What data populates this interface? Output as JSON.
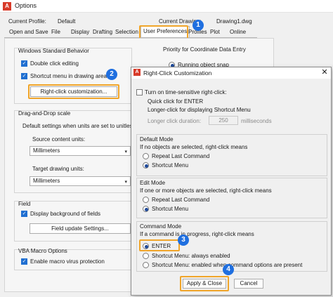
{
  "window": {
    "title": "Options",
    "icon_text": "A"
  },
  "profile": {
    "current_profile_label": "Current Profile:",
    "current_profile_value": "Default",
    "current_drawing_label": "Current Drawing:",
    "current_drawing_value": "Drawing1.dwg"
  },
  "tabs": [
    {
      "label": "Open and Save"
    },
    {
      "label": "File"
    },
    {
      "label": "Display"
    },
    {
      "label": "Drafting"
    },
    {
      "label": "Selection"
    },
    {
      "label": "User Preferences"
    },
    {
      "label": "Profiles"
    },
    {
      "label": "Plot"
    },
    {
      "label": "Online"
    }
  ],
  "windows_behavior": {
    "title": "Windows Standard Behavior",
    "double_click": "Double click editing",
    "shortcut_menu": "Shortcut menu in drawing area",
    "rc_button": "Right-click customization..."
  },
  "priority": {
    "title": "Priority for Coordinate Data Entry",
    "running_snap": "Running object snap"
  },
  "drag_drop": {
    "title": "Drag-and-Drop scale",
    "default_text": "Default settings when units are set to unitless",
    "source_label": "Source content units:",
    "source_value": "Millimeters",
    "target_label": "Target drawing units:",
    "target_value": "Millimeters"
  },
  "field": {
    "title": "Field",
    "display_background": "Display background of fields",
    "update_button": "Field update Settings..."
  },
  "vba": {
    "title": "VBA Macro Options",
    "enable_protection": "Enable macro virus protection"
  },
  "dialog": {
    "title": "Right-Click Customization",
    "time_sensitive": "Turn on time-sensitive right-click:",
    "quick_click": "Quick click for ENTER",
    "longer_click": "Longer-click for displaying Shortcut Menu",
    "duration_label": "Longer click duration:",
    "duration_value": "250",
    "duration_unit": "milliseconds",
    "default_mode": {
      "title": "Default Mode",
      "desc": "If no objects are selected, right-click means",
      "opt1": "Repeat Last Command",
      "opt2": "Shortcut Menu"
    },
    "edit_mode": {
      "title": "Edit Mode",
      "desc": "If one or more objects are selected, right-click means",
      "opt1": "Repeat Last Command",
      "opt2": "Shortcut Menu"
    },
    "command_mode": {
      "title": "Command Mode",
      "desc": "If a command is in progress, right-click means",
      "opt1": "ENTER",
      "opt2": "Shortcut Menu: always enabled",
      "opt3": "Shortcut Menu: enabled when command options are present"
    },
    "apply_button": "Apply & Close",
    "cancel_button": "Cancel"
  },
  "badges": {
    "b1": "1",
    "b2": "2",
    "b3": "3",
    "b4": "4"
  },
  "colors": {
    "highlight": "#f0a52a",
    "badge": "#1f6fe0",
    "accent": "#1f6fd1"
  }
}
